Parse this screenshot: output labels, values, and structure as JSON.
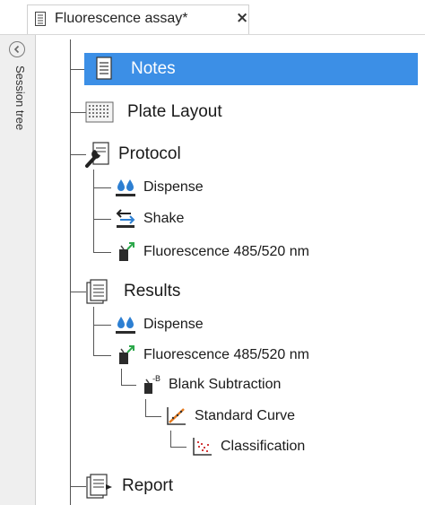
{
  "tab": {
    "title": "Fluorescence assay*",
    "close_glyph": "×",
    "icon": "document-icon"
  },
  "sidebar": {
    "label": "Session tree",
    "collapse_icon": "chevron-left-circle-icon"
  },
  "tree": {
    "items": [
      {
        "label": "Notes",
        "icon": "notes-icon",
        "selected": true
      },
      {
        "label": "Plate Layout",
        "icon": "plate-grid-icon"
      },
      {
        "label": "Protocol",
        "icon": "wrench-icon"
      },
      {
        "label": "Dispense",
        "icon": "dispense-drops-icon"
      },
      {
        "label": "Shake",
        "icon": "shake-arrows-icon"
      },
      {
        "label": "Fluorescence 485/520 nm",
        "icon": "fluorescence-icon"
      },
      {
        "label": "Results",
        "icon": "results-icon"
      },
      {
        "label": "Dispense",
        "icon": "dispense-drops-icon"
      },
      {
        "label": "Fluorescence 485/520 nm",
        "icon": "fluorescence-icon"
      },
      {
        "label": "Blank Subtraction",
        "icon": "blank-subtraction-icon",
        "badge": "-B"
      },
      {
        "label": "Standard Curve",
        "icon": "standard-curve-icon"
      },
      {
        "label": "Classification",
        "icon": "classification-icon"
      },
      {
        "label": "Report",
        "icon": "report-icon"
      }
    ]
  },
  "colors": {
    "selection": "#3c8fe6",
    "tree_line": "#555555",
    "drop_blue": "#2d7fd2",
    "arrow_green": "#2ba84a",
    "sidebar_bg": "#efefef"
  }
}
